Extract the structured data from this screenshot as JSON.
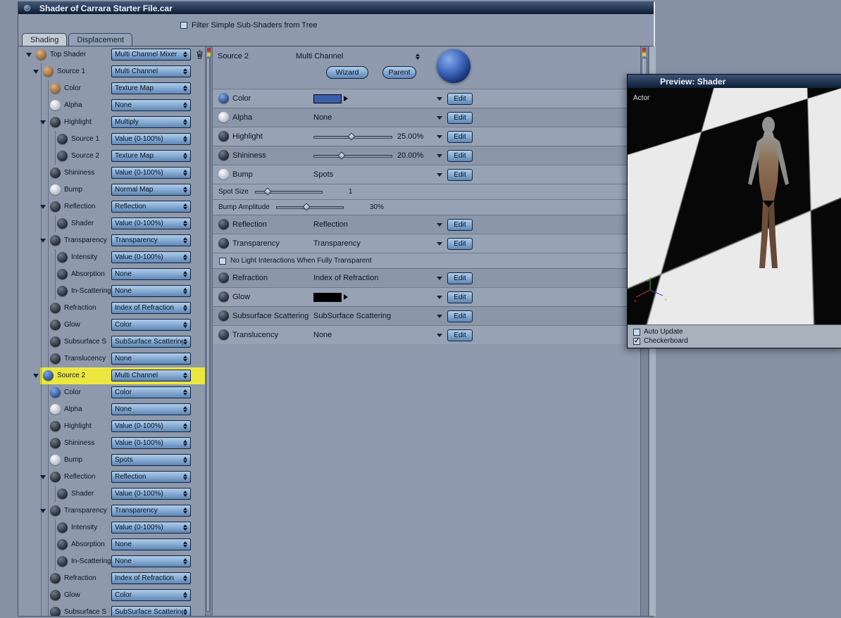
{
  "colors": {
    "highlight_yellow": "#ece73e",
    "accent_blue": "#5e88b8",
    "preview_sphere_blue": "#3a63b8",
    "color_swatch_blue": "#3a5fa8",
    "glow_swatch_black": "#000000"
  },
  "window": {
    "title": "Shader of Carrara Starter File.car",
    "filter_label": "Filter Simple Sub-Shaders from Tree",
    "filter_checked": false,
    "tabs": [
      {
        "label": "Shading",
        "active": true
      },
      {
        "label": "Displacement",
        "active": false
      }
    ]
  },
  "tree": [
    {
      "label": "Top Shader",
      "value": "Multi Channel Mixer",
      "level": 0,
      "icon": "brown",
      "expanded": true,
      "trash": true
    },
    {
      "label": "Source 1",
      "value": "Multi Channel",
      "level": 1,
      "icon": "brown",
      "expanded": true
    },
    {
      "label": "Color",
      "value": "Texture Map",
      "level": 2,
      "icon": "brown"
    },
    {
      "label": "Alpha",
      "value": "None",
      "level": 2,
      "icon": "white"
    },
    {
      "label": "Highlight",
      "value": "Multiply",
      "level": 2,
      "icon": "black",
      "expanded": true
    },
    {
      "label": "Source 1",
      "value": "Value (0-100%)",
      "level": 3,
      "icon": "black"
    },
    {
      "label": "Source 2",
      "value": "Texture Map",
      "level": 3,
      "icon": "black"
    },
    {
      "label": "Shininess",
      "value": "Value (0-100%)",
      "level": 2,
      "icon": "black"
    },
    {
      "label": "Bump",
      "value": "Normal Map",
      "level": 2,
      "icon": "white"
    },
    {
      "label": "Reflection",
      "value": "Reflection",
      "level": 2,
      "icon": "black",
      "expanded": true
    },
    {
      "label": "Shader",
      "value": "Value (0-100%)",
      "level": 3,
      "icon": "black"
    },
    {
      "label": "Transparency",
      "value": "Transparency",
      "level": 2,
      "icon": "black",
      "expanded": true
    },
    {
      "label": "Intensity",
      "value": "Value (0-100%)",
      "level": 3,
      "icon": "black"
    },
    {
      "label": "Absorption",
      "value": "None",
      "level": 3,
      "icon": "black"
    },
    {
      "label": "In-Scattering",
      "value": "None",
      "level": 3,
      "icon": "black"
    },
    {
      "label": "Refraction",
      "value": "Index of Refraction",
      "level": 2,
      "icon": "black"
    },
    {
      "label": "Glow",
      "value": "Color",
      "level": 2,
      "icon": "black"
    },
    {
      "label": "Subsurface S",
      "value": "SubSurface Scattering",
      "level": 2,
      "icon": "black"
    },
    {
      "label": "Translucency",
      "value": "None",
      "level": 2,
      "icon": "black"
    },
    {
      "label": "Source 2",
      "value": "Multi Channel",
      "level": 1,
      "icon": "blue",
      "expanded": true,
      "selected": true
    },
    {
      "label": "Color",
      "value": "Color",
      "level": 2,
      "icon": "blue"
    },
    {
      "label": "Alpha",
      "value": "None",
      "level": 2,
      "icon": "white"
    },
    {
      "label": "Highlight",
      "value": "Value (0-100%)",
      "level": 2,
      "icon": "black"
    },
    {
      "label": "Shininess",
      "value": "Value (0-100%)",
      "level": 2,
      "icon": "black"
    },
    {
      "label": "Bump",
      "value": "Spots",
      "level": 2,
      "icon": "white"
    },
    {
      "label": "Reflection",
      "value": "Reflection",
      "level": 2,
      "icon": "black",
      "expanded": true
    },
    {
      "label": "Shader",
      "value": "Value (0-100%)",
      "level": 3,
      "icon": "black"
    },
    {
      "label": "Transparency",
      "value": "Transparency",
      "level": 2,
      "icon": "black",
      "expanded": true
    },
    {
      "label": "Intensity",
      "value": "Value (0-100%)",
      "level": 3,
      "icon": "black"
    },
    {
      "label": "Absorption",
      "value": "None",
      "level": 3,
      "icon": "black"
    },
    {
      "label": "In-Scattering",
      "value": "None",
      "level": 3,
      "icon": "black"
    },
    {
      "label": "Refraction",
      "value": "Index of Refraction",
      "level": 2,
      "icon": "black"
    },
    {
      "label": "Glow",
      "value": "Color",
      "level": 2,
      "icon": "black"
    },
    {
      "label": "Subsurface S",
      "value": "SubSurface Scattering",
      "level": 2,
      "icon": "black"
    }
  ],
  "detail": {
    "name": "Source 2",
    "type": "Multi Channel",
    "wizard_label": "Wizard",
    "parent_label": "Parent",
    "edit_label": "Edit",
    "rows": [
      {
        "kind": "color",
        "label": "Color",
        "icon": "blue",
        "swatch": "#3a5fa8"
      },
      {
        "kind": "value",
        "label": "Alpha",
        "icon": "white",
        "value": "None"
      },
      {
        "kind": "slider",
        "label": "Highlight",
        "icon": "black",
        "value": "25.00%",
        "fraction": 0.48
      },
      {
        "kind": "slider",
        "label": "Shininess",
        "icon": "black",
        "value": "20.00%",
        "fraction": 0.35
      },
      {
        "kind": "value",
        "label": "Bump",
        "icon": "white",
        "value": "Spots"
      },
      {
        "kind": "subslider",
        "label": "Spot Size",
        "value": "1",
        "fraction": 0.18
      },
      {
        "kind": "subslider",
        "label": "Bump Amplitude",
        "value": "30%",
        "fraction": 0.45
      },
      {
        "kind": "value",
        "label": "Reflection",
        "icon": "black",
        "value": "Reflection"
      },
      {
        "kind": "value",
        "label": "Transparency",
        "icon": "black",
        "value": "Transparency"
      },
      {
        "kind": "checkbox",
        "label": "No Light Interactions When Fully Transparent",
        "checked": false
      },
      {
        "kind": "value",
        "label": "Refraction",
        "icon": "black",
        "value": "Index of Refraction"
      },
      {
        "kind": "color",
        "label": "Glow",
        "icon": "black",
        "swatch": "#000000"
      },
      {
        "kind": "value",
        "label": "Subsurface Scattering",
        "icon": "black",
        "value": "SubSurface Scattering"
      },
      {
        "kind": "value",
        "label": "Translucency",
        "icon": "black",
        "value": "None"
      }
    ]
  },
  "preview": {
    "title": "Preview: Shader",
    "mode_label": "Actor",
    "checkboxes": [
      {
        "label": "Auto Update",
        "checked": false
      },
      {
        "label": "Checkerboard",
        "checked": true
      }
    ]
  }
}
